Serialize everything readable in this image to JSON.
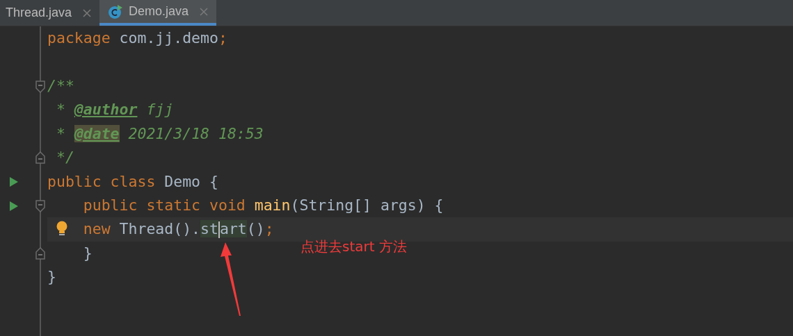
{
  "tabs": [
    {
      "label": "Thread.java",
      "selected": false,
      "icon": false
    },
    {
      "label": "Demo.java",
      "selected": true,
      "icon": true
    }
  ],
  "lines": [
    {
      "run": false,
      "fold_start": false,
      "fold_end": false,
      "bulb": false,
      "current": false,
      "tokens": [
        {
          "text": "package",
          "kind": "keyword"
        },
        {
          "text": " com.jj.demo",
          "kind": "plain"
        },
        {
          "text": ";",
          "kind": "punct"
        }
      ]
    },
    {
      "run": false,
      "fold_start": false,
      "fold_end": false,
      "bulb": false,
      "current": false
    },
    {
      "run": false,
      "fold_start": true,
      "fold_end": false,
      "bulb": false,
      "current": false,
      "tokens": [
        {
          "text": "/**",
          "kind": "comment"
        }
      ]
    },
    {
      "run": false,
      "fold_start": false,
      "fold_end": false,
      "bulb": false,
      "current": false,
      "tokens": [
        {
          "text": " * ",
          "kind": "comment"
        },
        {
          "text": "@author",
          "kind": "doc-tag"
        },
        {
          "text": " fjj",
          "kind": "comment"
        }
      ]
    },
    {
      "run": false,
      "fold_start": false,
      "fold_end": false,
      "bulb": false,
      "current": false,
      "tokens": [
        {
          "text": " * ",
          "kind": "comment"
        },
        {
          "text": "@date",
          "kind": "doc-tag-marked"
        },
        {
          "text": " 2021/3/18 18:53",
          "kind": "comment"
        }
      ]
    },
    {
      "run": false,
      "fold_start": false,
      "fold_end": true,
      "bulb": false,
      "current": false,
      "tokens": [
        {
          "text": " */",
          "kind": "comment"
        }
      ]
    },
    {
      "run": true,
      "fold_start": false,
      "fold_end": false,
      "bulb": false,
      "current": false,
      "tokens": [
        {
          "text": "public class ",
          "kind": "keyword"
        },
        {
          "text": "Demo {",
          "kind": "plain"
        }
      ]
    },
    {
      "run": true,
      "fold_start": true,
      "fold_end": false,
      "bulb": false,
      "current": false,
      "tokens": [
        {
          "text": "    public static void ",
          "kind": "keyword"
        },
        {
          "text": "main",
          "kind": "method"
        },
        {
          "text": "(String[] args) {",
          "kind": "plain"
        }
      ]
    },
    {
      "run": false,
      "fold_start": false,
      "fold_end": false,
      "bulb": true,
      "current": true,
      "tokens": [
        {
          "text": "    new ",
          "kind": "keyword"
        },
        {
          "text": "Thread().",
          "kind": "plain"
        },
        {
          "text": "st",
          "kind": "plain",
          "highlight": true,
          "caret": true
        },
        {
          "text": "art",
          "kind": "plain",
          "highlight": true,
          "caret": false
        },
        {
          "text": "()",
          "kind": "plain"
        },
        {
          "text": ";",
          "kind": "punct"
        }
      ]
    },
    {
      "run": false,
      "fold_start": false,
      "fold_end": true,
      "bulb": false,
      "current": false,
      "tokens": [
        {
          "text": "    }",
          "kind": "plain"
        }
      ]
    },
    {
      "run": false,
      "fold_start": false,
      "fold_end": false,
      "bulb": false,
      "current": false,
      "tokens": [
        {
          "text": "}",
          "kind": "plain"
        }
      ]
    }
  ],
  "annotation": {
    "text": "点进去start 方法"
  }
}
